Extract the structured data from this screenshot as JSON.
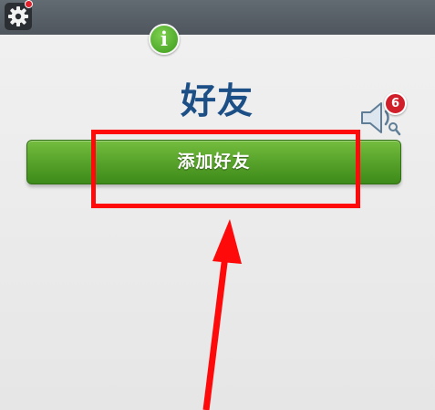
{
  "header": {
    "settings_icon": "gear-icon",
    "notification_dot_color": "#e0202a"
  },
  "panel": {
    "info_icon": "info-icon",
    "info_label": "i",
    "title": "好友",
    "sound_icon": "speaker-icon",
    "badge_count": "6",
    "add_friend_label": "添加好友"
  },
  "annotation": {
    "highlight_color": "#ff0a0a",
    "arrow_icon": "red-arrow-icon"
  }
}
